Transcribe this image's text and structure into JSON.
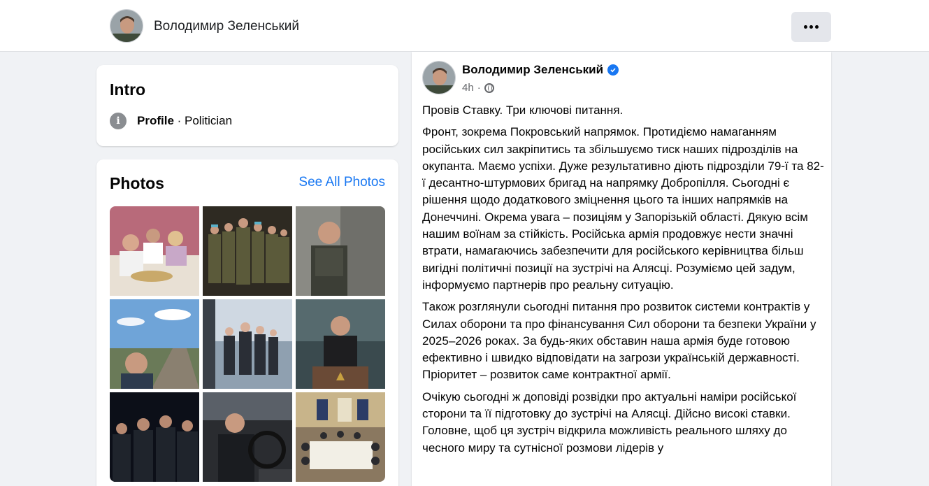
{
  "header": {
    "name": "Володимир Зеленський",
    "more_icon": "more-dots-icon"
  },
  "intro": {
    "title": "Intro",
    "icon": "info-icon",
    "profile_label": "Profile",
    "separator": " · ",
    "category": "Politician"
  },
  "photos": {
    "title": "Photos",
    "see_all": "See All Photos",
    "items": [
      {
        "desc": "family dinner table"
      },
      {
        "desc": "soldiers group"
      },
      {
        "desc": "man in vest outdoors"
      },
      {
        "desc": "selfie on bridge"
      },
      {
        "desc": "delegation walking"
      },
      {
        "desc": "speech at podium"
      },
      {
        "desc": "night group"
      },
      {
        "desc": "driving car"
      },
      {
        "desc": "conference room"
      }
    ]
  },
  "post": {
    "author": "Володимир Зеленський",
    "time": "4h",
    "meta_sep": "·",
    "paragraphs": [
      "Провів Ставку. Три ключові питання.",
      "Фронт, зокрема Покровський напрямок. Протидіємо намаганням російських сил закріпитись та збільшуємо тиск наших підрозділів на окупанта. Маємо успіхи. Дуже результативно діють підрозділи 79-ї та 82-ї десантно-штурмових бригад на напрямку Добропілля. Сьогодні є рішення щодо додаткового зміцнення цього та інших напрямків на Донеччині. Окрема увага – позиціям у Запорізькій області. Дякую всім нашим воїнам за стійкість. Російська армія продовжує нести значні втрати, намагаючись забезпечити для російського керівництва більш вигідні політичні позиції на зустрічі на Алясці. Розуміємо цей задум, інформуємо партнерів про реальну ситуацію.",
      "Також розглянули сьогодні питання про розвиток системи контрактів у Силах оборони та про фінансування Сил оборони та безпеки України у 2025–2026 роках. За будь-яких обставин наша армія буде готовою ефективно і швидко відповідати на загрози українській державності. Пріоритет – розвиток саме контрактної армії.",
      "Очікую сьогодні ж доповіді розвідки про актуальні наміри російської сторони та її підготовку до зустрічі на Алясці. Дійсно високі ставки. Головне, щоб ця зустріч відкрила можливість реального шляху до чесного миру та сутнісної розмови лідерів у"
    ]
  },
  "colors": {
    "accent": "#1877f2",
    "background": "#f0f2f5",
    "card": "#ffffff",
    "secondary_text": "#65676b"
  }
}
